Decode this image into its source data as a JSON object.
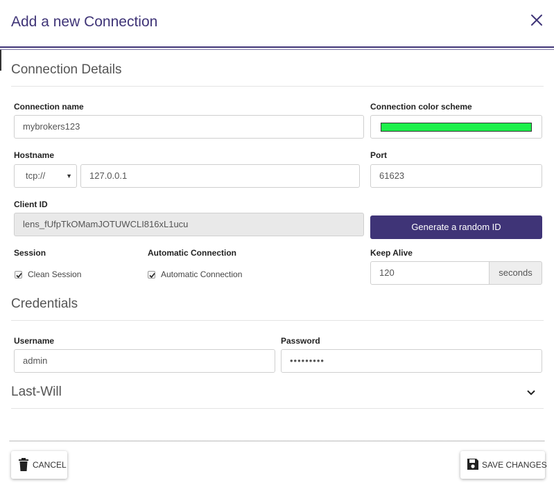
{
  "dialog": {
    "title": "Add a new Connection"
  },
  "connection_details": {
    "section_title": "Connection Details",
    "connection_name": {
      "label": "Connection name",
      "value": "mybrokers123"
    },
    "color_scheme": {
      "label": "Connection color scheme",
      "color": "#1cf04a"
    },
    "hostname": {
      "label": "Hostname",
      "protocol": "tcp://",
      "value": "127.0.0.1"
    },
    "port": {
      "label": "Port",
      "value": "61623"
    },
    "client_id": {
      "label": "Client ID",
      "value": "lens_fUfpTkOMamJOTUWCLI816xL1ucu",
      "generate_label": "Generate a random ID"
    },
    "session": {
      "label": "Session",
      "checkbox_label": "Clean Session",
      "checked": true
    },
    "automatic_connection": {
      "label": "Automatic Connection",
      "checkbox_label": "Automatic Connection",
      "checked": true
    },
    "keep_alive": {
      "label": "Keep Alive",
      "value": "120",
      "unit": "seconds"
    }
  },
  "credentials": {
    "section_title": "Credentials",
    "username": {
      "label": "Username",
      "value": "admin"
    },
    "password": {
      "label": "Password",
      "value": "•••••••••"
    }
  },
  "last_will": {
    "section_title": "Last-Will"
  },
  "footer": {
    "cancel_label": "CANCEL",
    "save_label": "SAVE CHANGES"
  },
  "colors": {
    "accent": "#3f3477"
  }
}
